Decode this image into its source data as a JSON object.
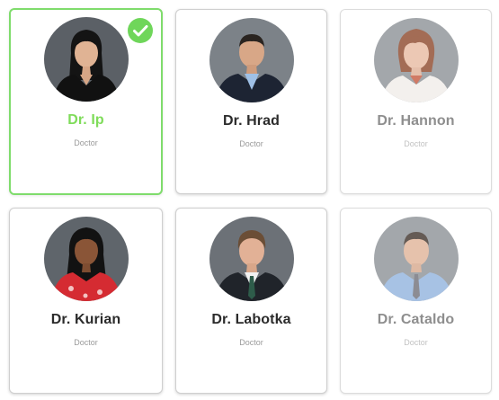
{
  "doctors": [
    {
      "name": "Dr. Ip",
      "role": "Doctor",
      "selected": true
    },
    {
      "name": "Dr. Hrad",
      "role": "Doctor",
      "selected": false
    },
    {
      "name": "Dr. Hannon",
      "role": "Doctor",
      "selected": false
    },
    {
      "name": "Dr. Kurian",
      "role": "Doctor",
      "selected": false
    },
    {
      "name": "Dr. Labotka",
      "role": "Doctor",
      "selected": false
    },
    {
      "name": "Dr. Cataldo",
      "role": "Doctor",
      "selected": false
    }
  ],
  "icons": {
    "selected_badge": "check-circle-icon"
  },
  "colors": {
    "accent": "#7fdc5a",
    "card_border": "#cfcfcf",
    "name_text": "#2b2b2b",
    "dim_text": "#8e8e8e"
  }
}
